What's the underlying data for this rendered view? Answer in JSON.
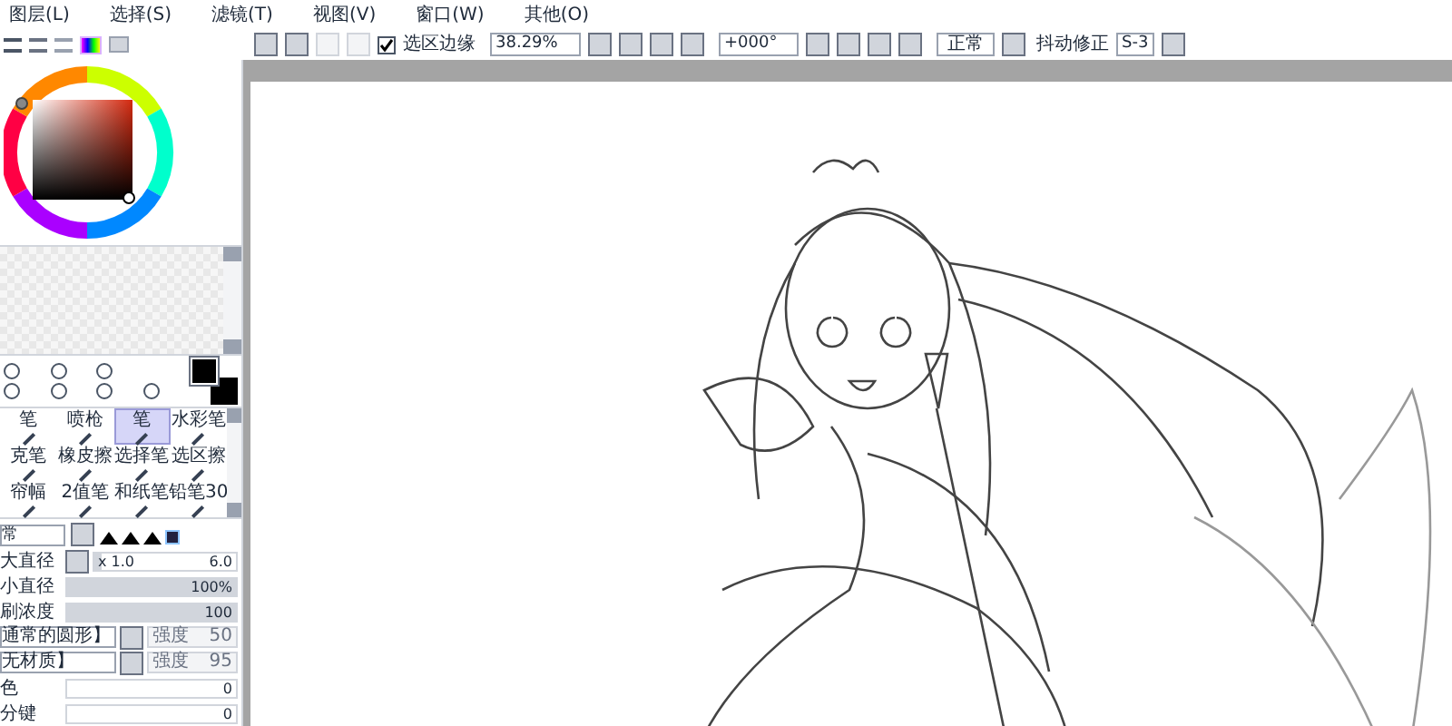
{
  "menu": [
    "图层(L)",
    "选择(S)",
    "滤镜(T)",
    "视图(V)",
    "窗口(W)",
    "其他(O)"
  ],
  "toolbar": {
    "selection_edge": {
      "label": "选区边缘",
      "checked": true
    },
    "zoom": "38.29%",
    "rotation": "+000°",
    "blend_mode": "正常",
    "stabilizer": {
      "label": "抖动修正",
      "value": "S-3"
    }
  },
  "tools": [
    {
      "label": "笔",
      "selected": false
    },
    {
      "label": "喷枪",
      "selected": false
    },
    {
      "label": "笔",
      "selected": true
    },
    {
      "label": "水彩笔",
      "selected": false
    },
    {
      "label": "克笔",
      "selected": false
    },
    {
      "label": "橡皮擦",
      "selected": false
    },
    {
      "label": "选择笔",
      "selected": false
    },
    {
      "label": "选区擦",
      "selected": false
    },
    {
      "label": "帘幅",
      "selected": false
    },
    {
      "label": "2值笔",
      "selected": false
    },
    {
      "label": "和纸笔",
      "selected": false
    },
    {
      "label": "铅笔30",
      "selected": false
    }
  ],
  "brush": {
    "mode": "常",
    "rows": [
      {
        "kind": "range",
        "label": "大直径",
        "multiplier": "x 1.0",
        "value": "6.0",
        "level": 0.05
      },
      {
        "kind": "bar",
        "label": "小直径",
        "value": "100%",
        "level": 1
      },
      {
        "kind": "bar",
        "label": "刷浓度",
        "value": "100",
        "level": 1
      },
      {
        "kind": "select",
        "label": "通常的圆形】",
        "option_label": "强度",
        "option_value": "50",
        "disabled": true
      },
      {
        "kind": "select",
        "label": "无材质】",
        "option_label": "强度",
        "option_value": "95",
        "disabled": true
      },
      {
        "kind": "bar",
        "label": "色",
        "value": "0",
        "level": 0
      },
      {
        "kind": "bar",
        "label": "分键",
        "value": "0",
        "level": 0
      }
    ]
  }
}
